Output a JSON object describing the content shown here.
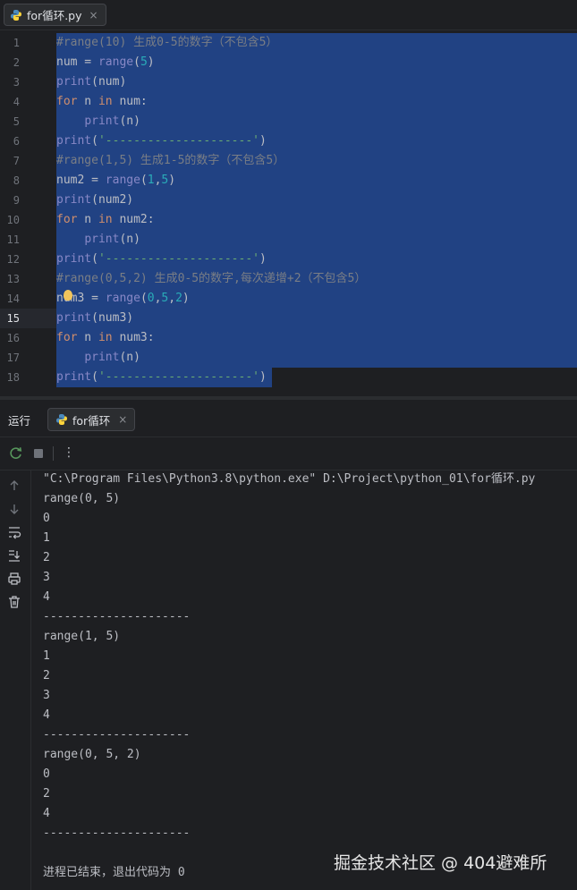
{
  "editor_tab": {
    "label": "for循环.py",
    "close": "×"
  },
  "editor": {
    "lines": [
      {
        "n": "1",
        "tokens": [
          {
            "c": "cm",
            "t": "#range(10) 生成0-5的数字（不包含5）"
          }
        ]
      },
      {
        "n": "2",
        "tokens": [
          {
            "c": "",
            "t": "num = "
          },
          {
            "c": "bi",
            "t": "range"
          },
          {
            "c": "",
            "t": "("
          },
          {
            "c": "num",
            "t": "5"
          },
          {
            "c": "",
            "t": ")"
          }
        ]
      },
      {
        "n": "3",
        "tokens": [
          {
            "c": "bi",
            "t": "print"
          },
          {
            "c": "",
            "t": "(num)"
          }
        ]
      },
      {
        "n": "4",
        "tokens": [
          {
            "c": "kw",
            "t": "for"
          },
          {
            "c": "",
            "t": " n "
          },
          {
            "c": "kw",
            "t": "in"
          },
          {
            "c": "",
            "t": " num:"
          }
        ]
      },
      {
        "n": "5",
        "tokens": [
          {
            "c": "",
            "t": "    "
          },
          {
            "c": "bi",
            "t": "print"
          },
          {
            "c": "",
            "t": "(n)"
          }
        ]
      },
      {
        "n": "6",
        "tokens": [
          {
            "c": "bi",
            "t": "print"
          },
          {
            "c": "",
            "t": "("
          },
          {
            "c": "str",
            "t": "'---------------------'"
          },
          {
            "c": "",
            "t": ")"
          }
        ]
      },
      {
        "n": "7",
        "tokens": [
          {
            "c": "cm",
            "t": "#range(1,5) 生成1-5的数字（不包含5）"
          }
        ]
      },
      {
        "n": "8",
        "tokens": [
          {
            "c": "",
            "t": "num2 = "
          },
          {
            "c": "bi",
            "t": "range"
          },
          {
            "c": "",
            "t": "("
          },
          {
            "c": "num",
            "t": "1"
          },
          {
            "c": "",
            "t": ","
          },
          {
            "c": "num",
            "t": "5"
          },
          {
            "c": "",
            "t": ")"
          }
        ]
      },
      {
        "n": "9",
        "tokens": [
          {
            "c": "bi",
            "t": "print"
          },
          {
            "c": "",
            "t": "(num2)"
          }
        ]
      },
      {
        "n": "10",
        "tokens": [
          {
            "c": "kw",
            "t": "for"
          },
          {
            "c": "",
            "t": " n "
          },
          {
            "c": "kw",
            "t": "in"
          },
          {
            "c": "",
            "t": " num2:"
          }
        ]
      },
      {
        "n": "11",
        "tokens": [
          {
            "c": "",
            "t": "    "
          },
          {
            "c": "bi",
            "t": "print"
          },
          {
            "c": "",
            "t": "(n)"
          }
        ]
      },
      {
        "n": "12",
        "tokens": [
          {
            "c": "bi",
            "t": "print"
          },
          {
            "c": "",
            "t": "("
          },
          {
            "c": "str",
            "t": "'---------------------'"
          },
          {
            "c": "",
            "t": ")"
          }
        ]
      },
      {
        "n": "13",
        "tokens": [
          {
            "c": "cm",
            "t": "#range(0,5,2) 生成0-5的数字,每次递增+2（不包含5）"
          }
        ]
      },
      {
        "n": "14",
        "tokens": [
          {
            "c": "",
            "t": "num3 = "
          },
          {
            "c": "bi",
            "t": "range"
          },
          {
            "c": "",
            "t": "("
          },
          {
            "c": "num",
            "t": "0"
          },
          {
            "c": "",
            "t": ","
          },
          {
            "c": "num",
            "t": "5"
          },
          {
            "c": "",
            "t": ","
          },
          {
            "c": "num",
            "t": "2"
          },
          {
            "c": "",
            "t": ")"
          }
        ]
      },
      {
        "n": "15",
        "tokens": [
          {
            "c": "bi",
            "t": "print"
          },
          {
            "c": "",
            "t": "(num3)"
          }
        ]
      },
      {
        "n": "16",
        "tokens": [
          {
            "c": "kw",
            "t": "for"
          },
          {
            "c": "",
            "t": " n "
          },
          {
            "c": "kw",
            "t": "in"
          },
          {
            "c": "",
            "t": " num3:"
          }
        ]
      },
      {
        "n": "17",
        "tokens": [
          {
            "c": "",
            "t": "    "
          },
          {
            "c": "bi",
            "t": "print"
          },
          {
            "c": "",
            "t": "(n)"
          }
        ]
      },
      {
        "n": "18",
        "tokens": [
          {
            "c": "bi",
            "t": "print"
          },
          {
            "c": "",
            "t": "("
          },
          {
            "c": "str",
            "t": "'---------------------'"
          },
          {
            "c": "",
            "t": ")"
          }
        ]
      }
    ],
    "current_line": "15"
  },
  "run_panel": {
    "label": "运行",
    "tab_label": "for循环",
    "tab_close": "×",
    "more_label": "⋮"
  },
  "console": {
    "lines": [
      "\"C:\\Program Files\\Python3.8\\python.exe\" D:\\Project\\python_01\\for循环.py",
      "range(0, 5)",
      "0",
      "1",
      "2",
      "3",
      "4",
      "---------------------",
      "range(1, 5)",
      "1",
      "2",
      "3",
      "4",
      "---------------------",
      "range(0, 5, 2)",
      "0",
      "2",
      "4",
      "---------------------",
      "",
      "进程已结束，退出代码为 0"
    ]
  },
  "watermark": "掘金技术社区 @ 404避难所",
  "colors": {
    "background": "#1e1f22",
    "selection": "#214283",
    "keyword": "#cf8e6d",
    "builtin": "#8888c6",
    "number": "#2aacb8",
    "string": "#6aab73",
    "comment": "#7a7e85"
  }
}
